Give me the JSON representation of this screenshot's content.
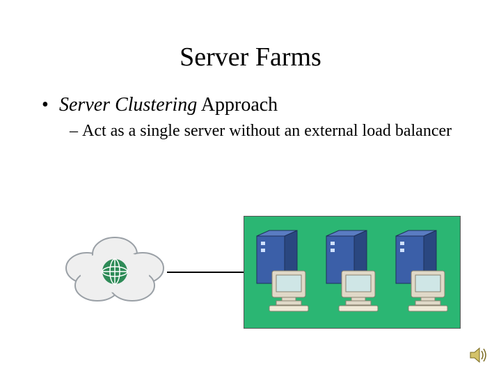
{
  "title": "Server Farms",
  "bullet": {
    "italic_part": "Server Clustering",
    "rest": " Approach"
  },
  "sub_bullet": "Act as a single server without an external load balancer",
  "icons": {
    "cloud": "internet-cloud",
    "server": "server-with-monitor",
    "speaker": "audio-speaker"
  },
  "colors": {
    "cluster_bg": "#2bb673",
    "server_blue": "#3b5fa8",
    "server_blue_dark": "#2a4780",
    "monitor_body": "#e0d9c8",
    "monitor_screen": "#cfe6e6",
    "cloud_fill": "#efefef",
    "cloud_stroke": "#9aa0a6",
    "globe": "#2e8b57"
  }
}
